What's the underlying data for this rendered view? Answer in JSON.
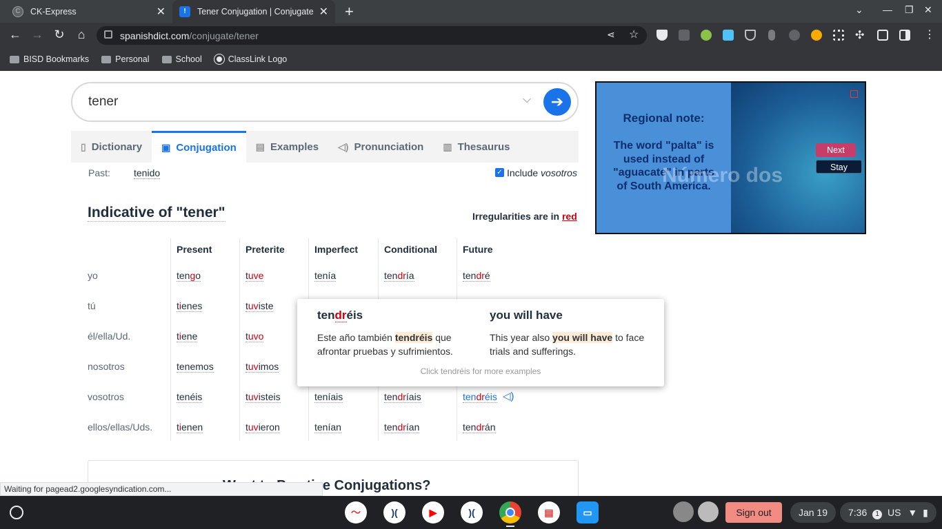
{
  "browser": {
    "tabs": [
      {
        "title": "CK-Express"
      },
      {
        "title": "Tener Conjugation | Conjugate T"
      }
    ],
    "url_host": "spanishdict.com",
    "url_path": "/conjugate/tener",
    "bookmarks": [
      "BISD Bookmarks",
      "Personal",
      "School",
      "ClassLink Logo"
    ],
    "status": "Waiting for pagead2.googlesyndication.com..."
  },
  "search": {
    "value": "tener"
  },
  "page_tabs": [
    "Dictionary",
    "Conjugation",
    "Examples",
    "Pronunciation",
    "Thesaurus"
  ],
  "past": {
    "label": "Past:",
    "value": "tenido"
  },
  "include_vosotros": {
    "prefix": "Include ",
    "word": "vosotros",
    "checked": true
  },
  "indicative": {
    "title": "Indicative of \"tener\"",
    "irregular_note": "Irregularities are in ",
    "irregular_word": "red",
    "columns": [
      "Present",
      "Preterite",
      "Imperfect",
      "Conditional",
      "Future"
    ],
    "pronouns": [
      "yo",
      "tú",
      "él/ella/Ud.",
      "nosotros",
      "vosotros",
      "ellos/ellas/Uds."
    ]
  },
  "popup": {
    "word_pre": "ten",
    "word_irr": "dr",
    "word_post": "éis",
    "translation": "you will have",
    "es_pre": "Este año también ",
    "es_hl": "tendréis",
    "es_post": " que afrontar pruebas y sufrimientos.",
    "en_pre": "This year also ",
    "en_hl": "you will have",
    "en_post": " to face trials and sufferings.",
    "more": "Click tendréis for more examples"
  },
  "ad": {
    "title": "Regional note:",
    "body": "The word \"palta\" is used instead of \"aguacate\" in parts of South America.",
    "overlay": "Número dos",
    "next": "Next",
    "stay": "Stay"
  },
  "practice": {
    "title": "Want to Practice Conjugations?"
  },
  "shelf": {
    "signout": "Sign out",
    "date": "Jan 19",
    "time": "7:36",
    "badge": "1",
    "locale": "US"
  }
}
